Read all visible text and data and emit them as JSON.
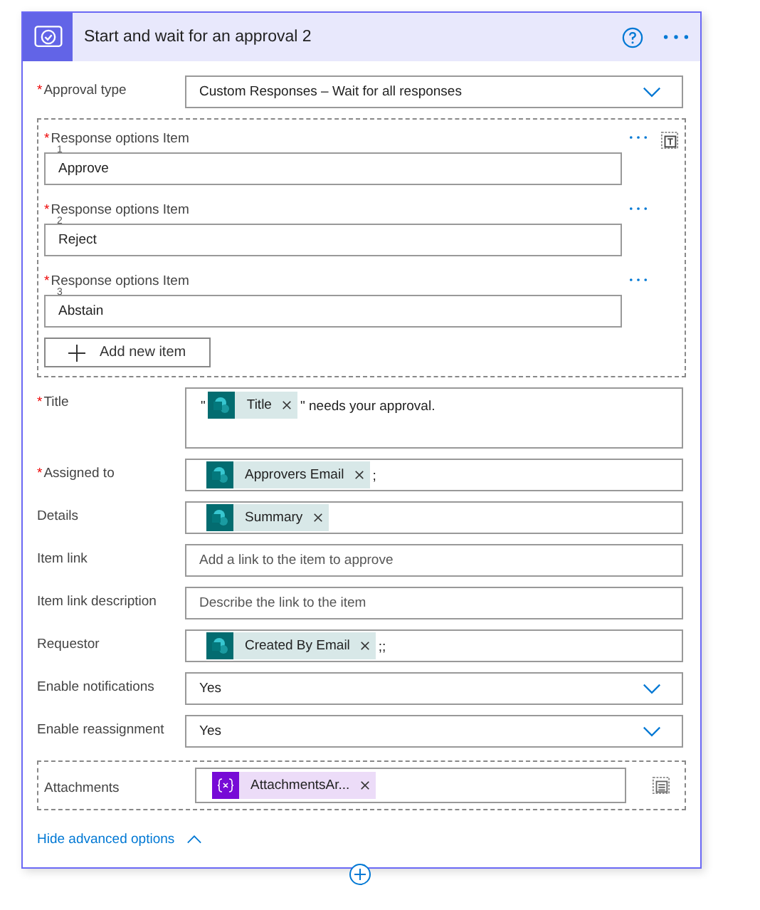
{
  "header": {
    "title": "Start and wait for an approval 2"
  },
  "fields": [
    {
      "kind": "dropdown",
      "label": "Approval type",
      "required_mark": "*",
      "value": "Custom Responses – Wait for all responses"
    },
    {
      "kind": "array",
      "add_label": "Add new item",
      "items": [
        {
          "label": "Response options Item",
          "required_mark": "*",
          "index": "1",
          "value": "Approve"
        },
        {
          "label": "Response options Item",
          "required_mark": "*",
          "index": "2",
          "value": "Reject"
        },
        {
          "label": "Response options Item",
          "required_mark": "*",
          "index": "3",
          "value": "Abstain"
        }
      ]
    },
    {
      "kind": "tokens",
      "label": "Title",
      "required_mark": "*",
      "tall": true,
      "parts": [
        {
          "kind": "text",
          "text": "\""
        },
        {
          "kind": "sharepoint",
          "text": "Title"
        },
        {
          "kind": "text",
          "text": "\" needs your approval."
        }
      ]
    },
    {
      "kind": "tokens",
      "label": "Assigned to",
      "required_mark": "*",
      "parts": [
        {
          "kind": "sharepoint",
          "text": "Approvers Email"
        },
        {
          "kind": "text",
          "text": ";"
        }
      ]
    },
    {
      "kind": "tokens",
      "label": "Details",
      "parts": [
        {
          "kind": "sharepoint",
          "text": "Summary"
        }
      ]
    },
    {
      "kind": "text",
      "label": "Item link",
      "placeholder": "Add a link to the item to approve"
    },
    {
      "kind": "text",
      "label": "Item link description",
      "placeholder": "Describe the link to the item"
    },
    {
      "kind": "tokens",
      "label": "Requestor",
      "parts": [
        {
          "kind": "sharepoint",
          "text": "Created By Email"
        },
        {
          "kind": "text",
          "text": ";;"
        }
      ]
    },
    {
      "kind": "dropdown",
      "label": "Enable notifications",
      "value": "Yes"
    },
    {
      "kind": "dropdown",
      "label": "Enable reassignment",
      "value": "Yes"
    },
    {
      "kind": "attachments",
      "label": "Attachments",
      "parts": [
        {
          "kind": "variable",
          "text": "AttachmentsAr..."
        }
      ]
    }
  ],
  "advanced_link": "Hide advanced options"
}
